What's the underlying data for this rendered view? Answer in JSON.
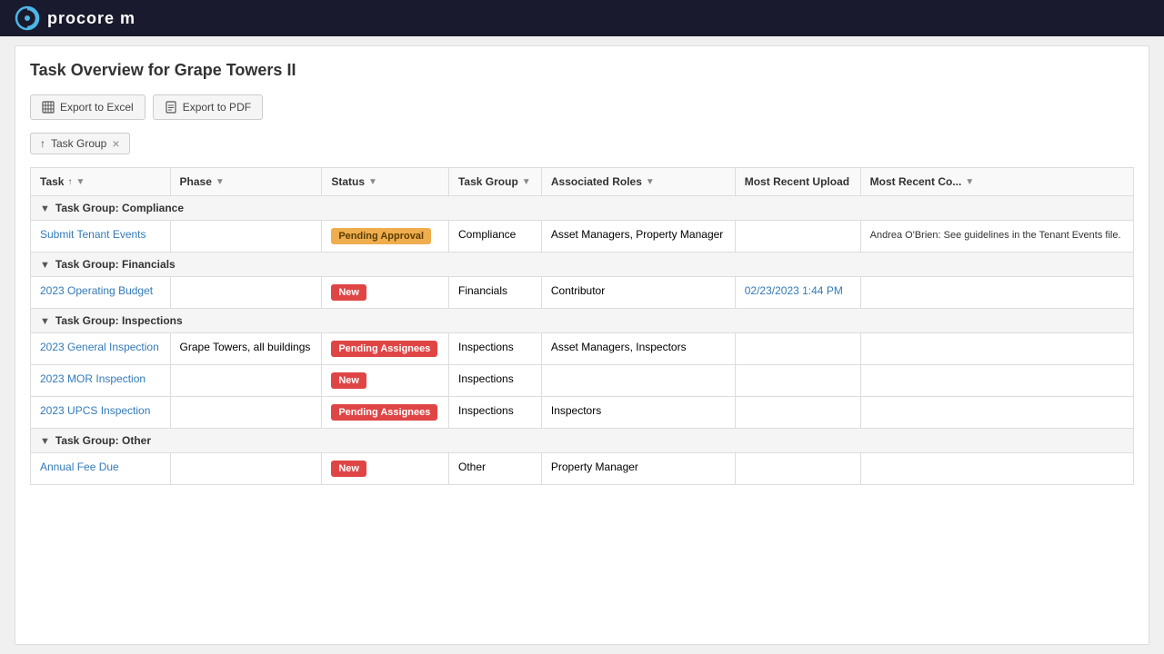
{
  "navbar": {
    "logo_alt": "Procore logo",
    "logo_text": "procore m"
  },
  "page": {
    "title": "Task Overview for Grape Towers II"
  },
  "toolbar": {
    "export_excel_label": "Export to Excel",
    "export_pdf_label": "Export to PDF"
  },
  "filter_bar": {
    "filter_label": "Task Group",
    "filter_close": "×"
  },
  "table": {
    "columns": [
      {
        "key": "task",
        "label": "Task",
        "sortable": true,
        "filterable": true
      },
      {
        "key": "phase",
        "label": "Phase",
        "sortable": false,
        "filterable": true
      },
      {
        "key": "status",
        "label": "Status",
        "sortable": false,
        "filterable": true
      },
      {
        "key": "task_group",
        "label": "Task Group",
        "sortable": false,
        "filterable": true
      },
      {
        "key": "associated_roles",
        "label": "Associated Roles",
        "sortable": false,
        "filterable": true
      },
      {
        "key": "most_recent_upload",
        "label": "Most Recent Upload",
        "sortable": false,
        "filterable": false
      },
      {
        "key": "most_recent_comment",
        "label": "Most Recent Co...",
        "sortable": false,
        "filterable": true
      }
    ],
    "groups": [
      {
        "name": "Task Group: Compliance",
        "rows": [
          {
            "task": "Submit Tenant Events",
            "phase": "",
            "status": "Pending Approval",
            "status_type": "pending-approval",
            "task_group": "Compliance",
            "associated_roles": "Asset Managers, Property Manager",
            "most_recent_upload": "",
            "most_recent_comment": "Andrea O'Brien: See guidelines in the Tenant Events file."
          }
        ]
      },
      {
        "name": "Task Group: Financials",
        "rows": [
          {
            "task": "2023 Operating Budget",
            "phase": "",
            "status": "New",
            "status_type": "new",
            "task_group": "Financials",
            "associated_roles": "Contributor",
            "most_recent_upload": "02/23/2023 1:44 PM",
            "most_recent_comment": ""
          }
        ]
      },
      {
        "name": "Task Group: Inspections",
        "rows": [
          {
            "task": "2023 General Inspection",
            "phase": "Grape Towers, all buildings",
            "status": "Pending Assignees",
            "status_type": "pending-assignees",
            "task_group": "Inspections",
            "associated_roles": "Asset Managers, Inspectors",
            "most_recent_upload": "",
            "most_recent_comment": ""
          },
          {
            "task": "2023 MOR Inspection",
            "phase": "",
            "status": "New",
            "status_type": "new",
            "task_group": "Inspections",
            "associated_roles": "",
            "most_recent_upload": "",
            "most_recent_comment": ""
          },
          {
            "task": "2023 UPCS Inspection",
            "phase": "",
            "status": "Pending Assignees",
            "status_type": "pending-assignees",
            "task_group": "Inspections",
            "associated_roles": "Inspectors",
            "most_recent_upload": "",
            "most_recent_comment": ""
          }
        ]
      },
      {
        "name": "Task Group: Other",
        "rows": [
          {
            "task": "Annual Fee Due",
            "phase": "",
            "status": "New",
            "status_type": "new",
            "task_group": "Other",
            "associated_roles": "Property Manager",
            "most_recent_upload": "",
            "most_recent_comment": ""
          }
        ]
      }
    ]
  }
}
